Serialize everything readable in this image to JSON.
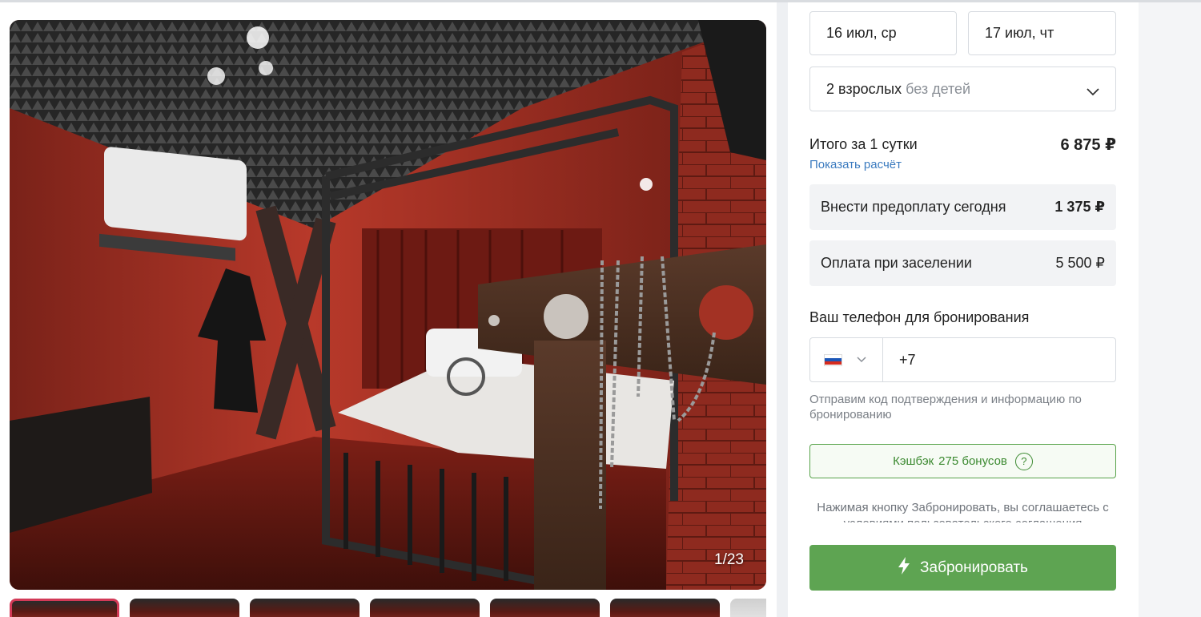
{
  "gallery": {
    "counter": "1/23",
    "thumbnails": [
      "thumb-1",
      "thumb-2",
      "thumb-3",
      "thumb-4",
      "thumb-5",
      "thumb-6",
      "thumb-7"
    ]
  },
  "booking": {
    "checkin": "16 июл, ср",
    "checkout": "17 июл, чт",
    "guests_adults": "2 взрослых",
    "guests_children": "без детей",
    "total_label": "Итого за 1 сутки",
    "total_value": "6 875 ₽",
    "calc_link": "Показать расчёт",
    "prepay_label": "Внести предоплату сегодня",
    "prepay_value": "1 375 ₽",
    "onsite_label": "Оплата при заселении",
    "onsite_value": "5 500 ₽",
    "phone_label": "Ваш телефон для бронирования",
    "phone_value": "+7",
    "hint": "Отправим код подтверждения и информацию по бронированию",
    "cashback_label": "Кэшбэк",
    "cashback_value": "275 бонусов",
    "terms": "Нажимая кнопку Забронировать, вы соглашаетесь с условиями пользовательского соглашения",
    "book_button": "Забронировать"
  },
  "colors": {
    "accent_green": "#5ea452",
    "link_blue": "#3b7bbf",
    "active_thumb_border": "#d23a57"
  },
  "icons": {
    "chevron": "chevron-down-icon",
    "flag": "russia-flag-icon",
    "help": "question-circle-icon",
    "bolt": "lightning-icon"
  }
}
